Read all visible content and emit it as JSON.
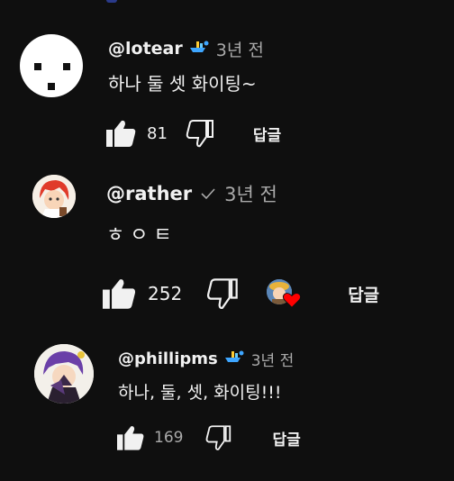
{
  "comments": [
    {
      "author": "@lotear",
      "badge_icon": "member-badge-icon",
      "time": "3년 전",
      "text": "하나 둘 셋 화이팅~",
      "likes": "81",
      "reply_label": "답글"
    },
    {
      "author": "@rather",
      "badge_icon": "checkmark-icon",
      "time": "3년 전",
      "text": "ㅎㅇㅌ",
      "likes": "252",
      "reply_label": "답글",
      "creator_heart": true
    },
    {
      "author": "@phillipms",
      "badge_icon": "member-badge-icon",
      "time": "3년 전",
      "text": "하나, 둘, 셋, 화이팅!!!",
      "likes": "169",
      "reply_label": "답글"
    }
  ],
  "colors": {
    "background": "#0f0f0f",
    "text": "#f1f1f1",
    "secondary": "#aaaaaa",
    "heart": "#ff0000"
  }
}
